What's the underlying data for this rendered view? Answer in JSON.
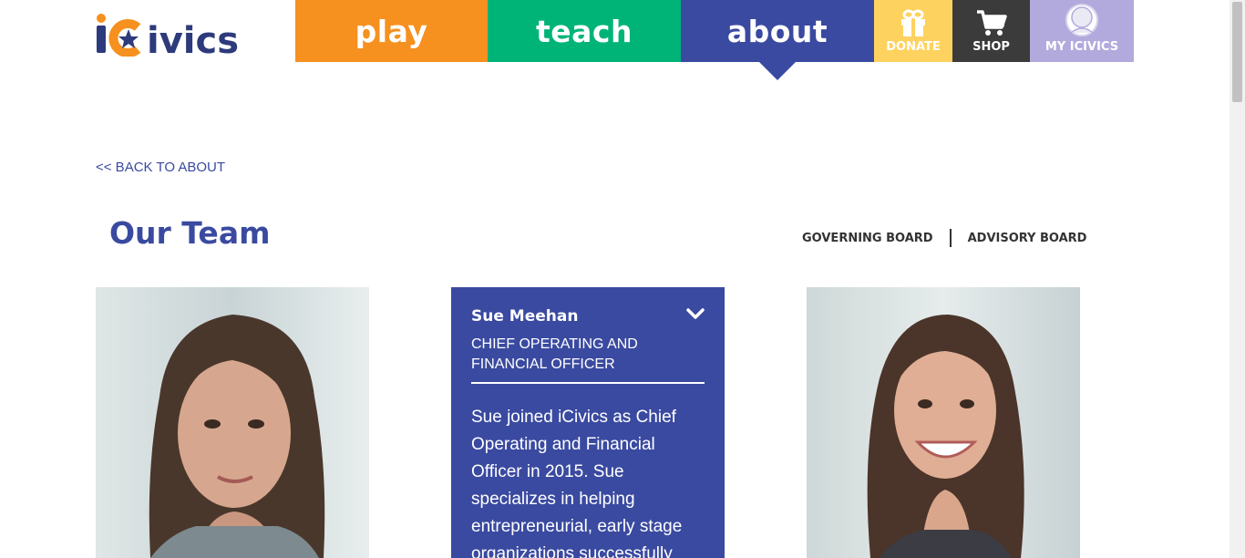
{
  "header": {
    "logo_text": "iCivics",
    "nav": {
      "play": "play",
      "teach": "teach",
      "about": "about",
      "donate": "DONATE",
      "shop": "SHOP",
      "my_icivics": "MY ICIVICS"
    }
  },
  "back_link": "<< BACK TO ABOUT",
  "page_title": "Our Team",
  "board_links": {
    "governing": "GOVERNING BOARD",
    "advisory": "ADVISORY BOARD"
  },
  "team": {
    "featured": {
      "name": "Sue Meehan",
      "role": "CHIEF OPERATING AND FINANCIAL OFFICER",
      "bio": "Sue joined iCivics as Chief Operating and Financial Officer in 2015.    Sue specializes in helping entrepreneurial, early stage organizations successfully"
    }
  },
  "colors": {
    "play": "#f6901e",
    "teach": "#00b478",
    "about": "#3a4aa0",
    "donate": "#fed25e",
    "shop": "#3b3b3b",
    "my_icivics": "#b2aadd"
  }
}
